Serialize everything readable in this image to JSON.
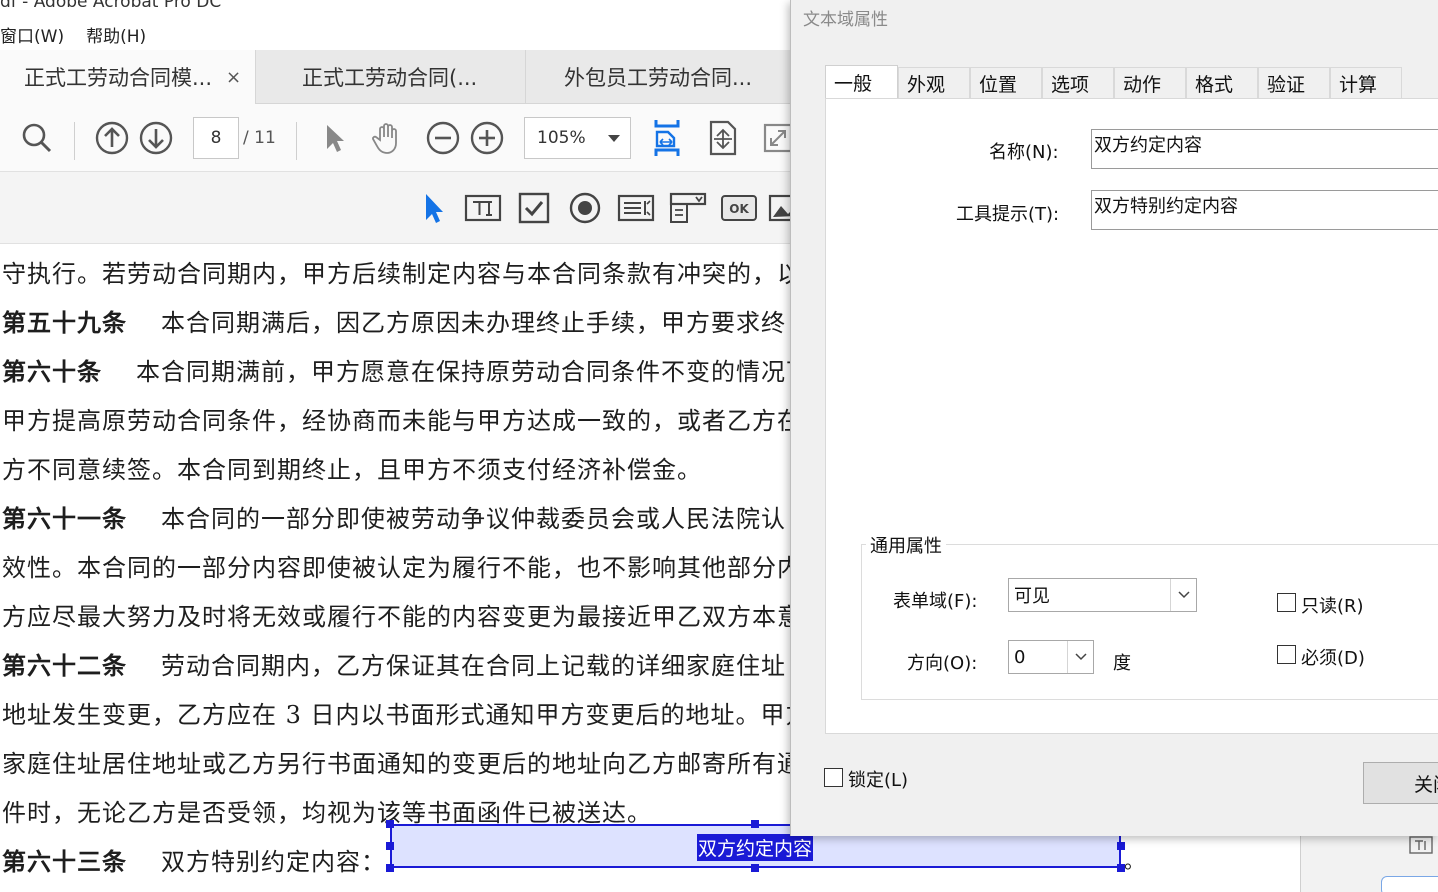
{
  "app": {
    "title": "df - Adobe Acrobat Pro DC"
  },
  "menu": {
    "items": [
      "窗口(W)",
      "帮助(H)"
    ]
  },
  "doc_tabs": [
    {
      "label": "正式工劳动合同模...",
      "close": "×"
    },
    {
      "label": "正式工劳动合同(..."
    },
    {
      "label": "外包员工劳动合同..."
    }
  ],
  "toolbar": {
    "page_current": "8",
    "page_total": "/ 11",
    "zoom": "105%"
  },
  "document": {
    "lines": [
      {
        "heading": "",
        "text": "守执行。若劳动合同期内，甲方后续制定内容与本合同条款有冲突的，以"
      },
      {
        "heading": "第五十九条",
        "text": "本合同期满后，因乙方原因未办理终止手续，甲方要求终"
      },
      {
        "heading": "第六十条",
        "text": "本合同期满前，甲方愿意在保持原劳动合同条件不变的情况下"
      },
      {
        "heading": "",
        "text": "甲方提高原劳动合同条件，经协商而未能与甲方达成一致的，或者乙方在"
      },
      {
        "heading": "",
        "text": "方不同意续签。本合同到期终止，且甲方不须支付经济补偿金。"
      },
      {
        "heading": "第六十一条",
        "text": "本合同的一部分即使被劳动争议仲裁委员会或人民法院认"
      },
      {
        "heading": "",
        "text": "效性。本合同的一部分内容即使被认定为履行不能，也不影响其他部分内"
      },
      {
        "heading": "",
        "text": "方应尽最大努力及时将无效或履行不能的内容变更为最接近甲乙双方本意"
      },
      {
        "heading": "第六十二条",
        "text": "劳动合同期内，乙方保证其在合同上记载的详细家庭住址"
      },
      {
        "heading": "",
        "text": "地址发生变更，乙方应在 3 日内以书面形式通知甲方变更后的地址。甲方"
      },
      {
        "heading": "",
        "text": "家庭住址居住地址或乙方另行书面通知的变更后的地址向乙方邮寄所有通"
      },
      {
        "heading": "",
        "text": "件时，无论乙方是否受领，均视为该等书面函件已被送达。"
      },
      {
        "heading": "第六十三条",
        "text": "双方特别约定内容："
      }
    ],
    "field_value": "双方约定内容",
    "field_suffix": "。"
  },
  "dialog": {
    "title": "文本域属性",
    "tabs": [
      "一般",
      "外观",
      "位置",
      "选项",
      "动作",
      "格式",
      "验证",
      "计算"
    ],
    "active_tab": "一般",
    "name_label": "名称(N):",
    "name_value": "双方约定内容",
    "tooltip_label": "工具提示(T):",
    "tooltip_value": "双方特别约定内容",
    "common_group": "通用属性",
    "form_field_label": "表单域(F):",
    "form_field_value": "可见",
    "orientation_label": "方向(O):",
    "orientation_value": "0",
    "orientation_unit": "度",
    "readonly_label": "只读(R)",
    "required_label": "必须(D)",
    "locked_label": "锁定(L)",
    "close_button": "关闭"
  },
  "colors": {
    "accent": "#1473e6",
    "field_highlight": "#dde2ff",
    "selection": "#1a1ad6"
  }
}
